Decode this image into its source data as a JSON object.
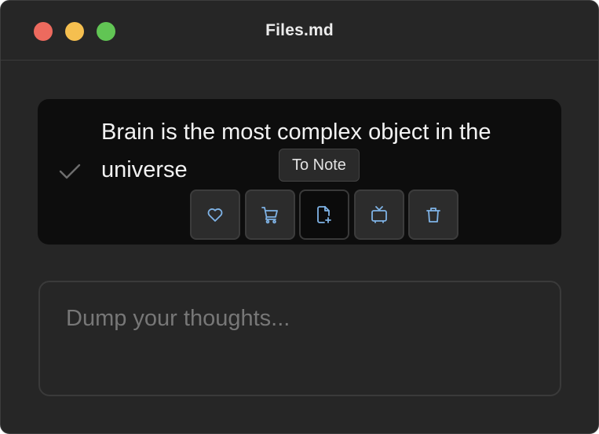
{
  "window": {
    "title": "Files.md",
    "controls": {
      "close_color": "#ed6a5e",
      "minimize_color": "#f5bf4f",
      "zoom_color": "#61c554"
    }
  },
  "note": {
    "text": "Brain is the most complex object in the universe",
    "status_icon": "check-icon"
  },
  "tooltip": {
    "label": "To Note"
  },
  "actions": [
    {
      "name": "favorite",
      "icon": "heart-icon"
    },
    {
      "name": "shopping",
      "icon": "cart-icon"
    },
    {
      "name": "to-note",
      "icon": "file-plus-icon",
      "active": true
    },
    {
      "name": "watch",
      "icon": "tv-icon"
    },
    {
      "name": "delete",
      "icon": "trash-icon"
    }
  ],
  "input": {
    "placeholder": "Dump your thoughts...",
    "value": ""
  },
  "colors": {
    "accent_icon": "#7fb3e6",
    "background": "#262626",
    "card": "#0d0d0d"
  }
}
